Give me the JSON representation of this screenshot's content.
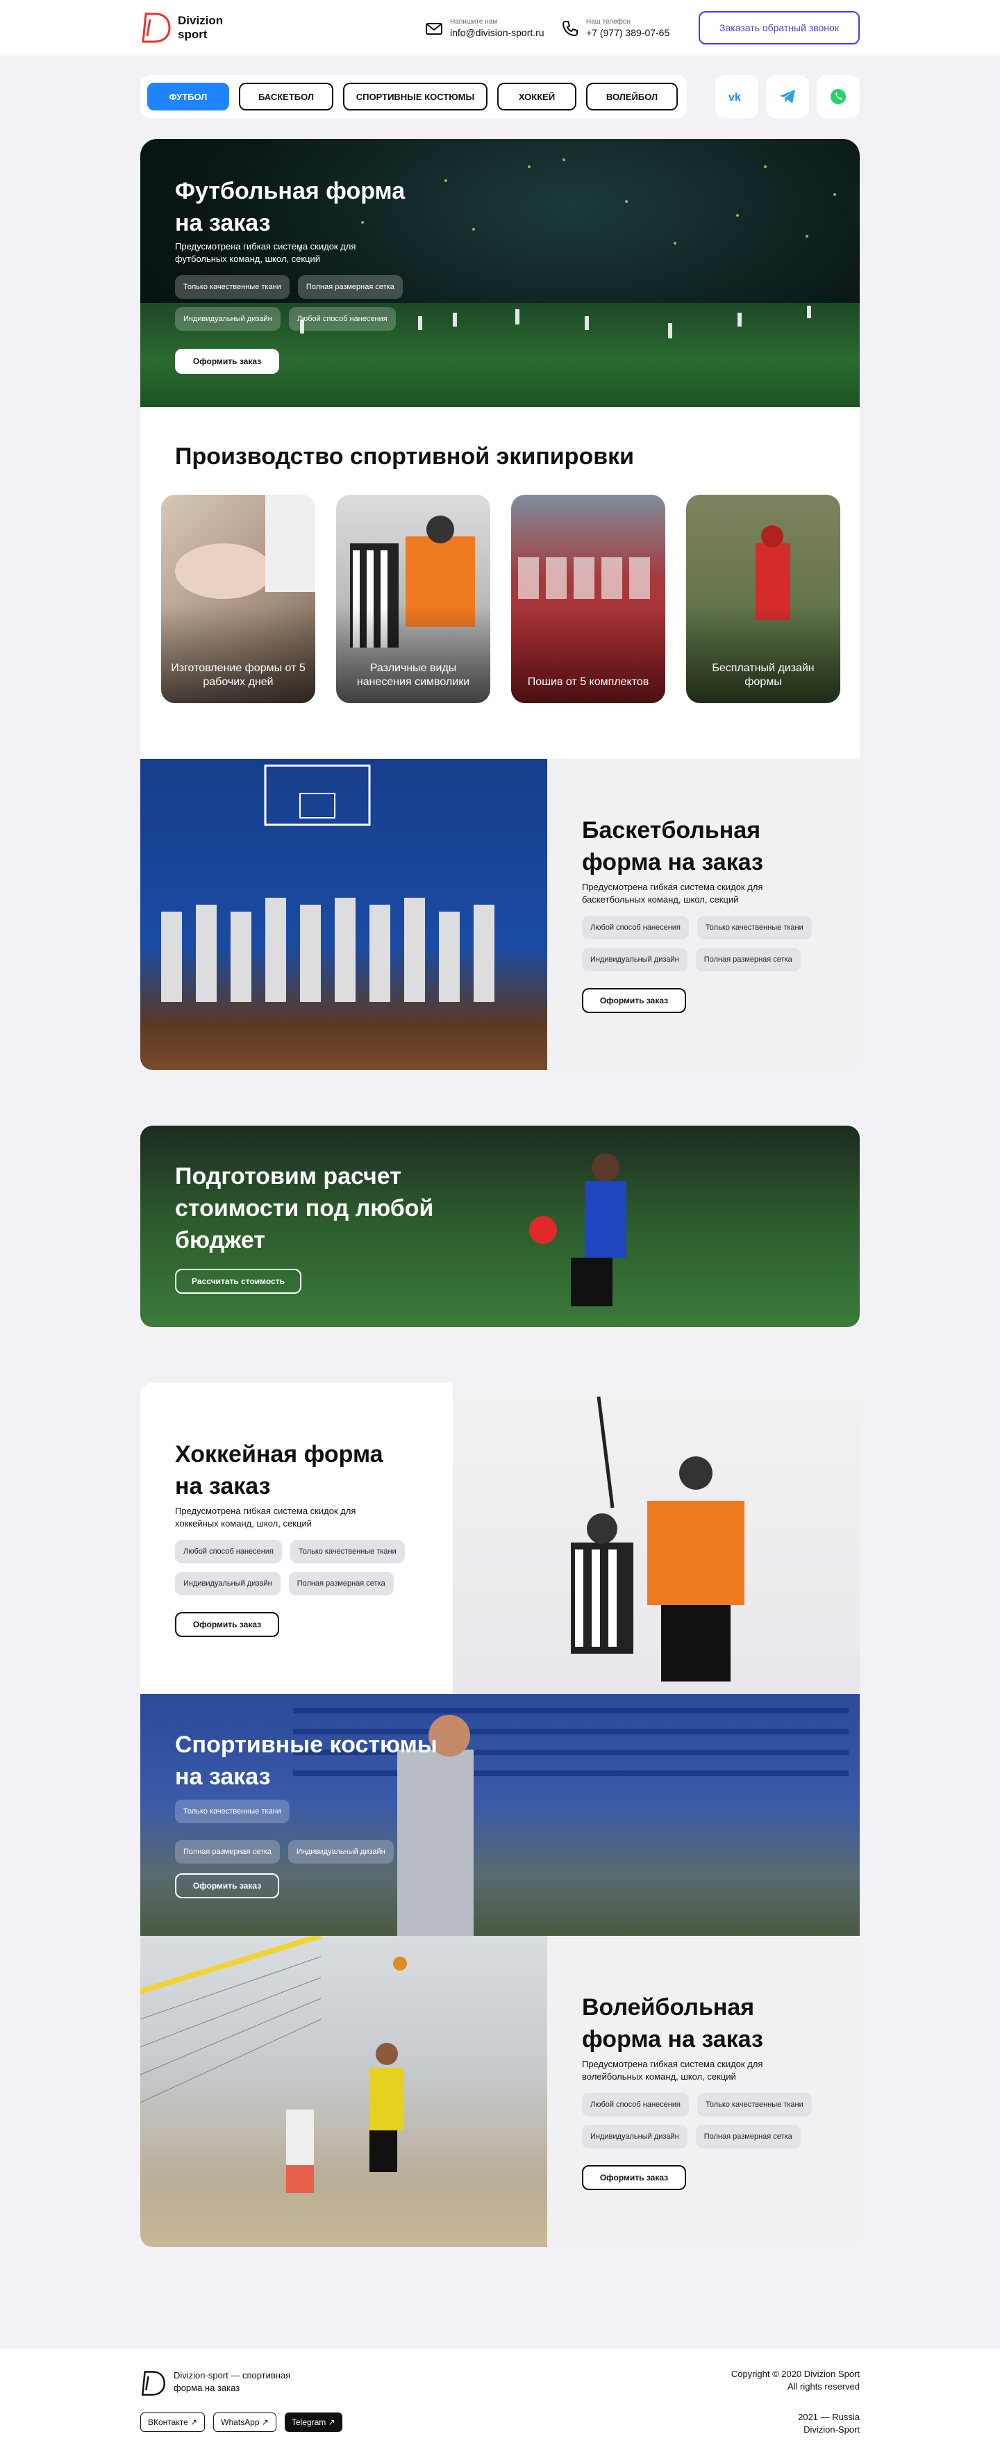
{
  "header": {
    "logo_line1": "Divizion",
    "logo_line2": "sport",
    "email_label": "Напишите нам",
    "email": "info@division-sport.ru",
    "phone_label": "Наш телефон",
    "phone": "+7 (977) 389-07-65",
    "callback_button": "Заказать обратный звонок"
  },
  "tabs": [
    {
      "label": "ФУТБОЛ",
      "active": true
    },
    {
      "label": "БАСКЕТБОЛ",
      "active": false
    },
    {
      "label": "СПОРТИВНЫЕ КОСТЮМЫ",
      "active": false
    },
    {
      "label": "ХОККЕЙ",
      "active": false
    },
    {
      "label": "ВОЛЕЙБОЛ",
      "active": false
    }
  ],
  "social": [
    "vk-icon",
    "telegram-icon",
    "whatsapp-icon"
  ],
  "colors": {
    "accent": "#1f84ff",
    "callback": "#4a3fd8",
    "bg": "#f1f1f6"
  },
  "football": {
    "title": "Футбольная форма на заказ",
    "subtitle": "Предусмотрена гибкая система скидок для футбольных команд, школ, секций",
    "chips": [
      "Только качественные ткани",
      "Полная размерная сетка",
      "Индивидуальный дизайн",
      "Любой способ нанесения"
    ],
    "button": "Оформить заказ"
  },
  "production": {
    "title": "Производство спортивной экипировки",
    "cards": [
      {
        "caption": "Изготовление формы от 5 рабочих дней"
      },
      {
        "caption": "Различные виды нанесения символики"
      },
      {
        "caption": "Пошив от 5 комплектов"
      },
      {
        "caption": "Бесплатный дизайн формы"
      }
    ]
  },
  "basketball": {
    "title": "Баскетбольная форма на заказ",
    "subtitle": "Предусмотрена гибкая система скидок для баскетбольных команд, школ, секций",
    "chips": [
      "Любой способ нанесения",
      "Только качественные ткани",
      "Индивидуальный дизайн",
      "Полная размерная сетка"
    ],
    "button": "Оформить заказ"
  },
  "calc": {
    "title": "Подготовим расчет стоимости под любой бюджет",
    "button": "Рассчитать стоимость"
  },
  "hockey": {
    "title": "Хоккейная форма на заказ",
    "subtitle": "Предусмотрена гибкая система скидок для хоккейных команд, школ, секций",
    "chips": [
      "Любой способ нанесения",
      "Только качественные ткани",
      "Индивидуальный дизайн",
      "Полная размерная сетка"
    ],
    "button": "Оформить заказ"
  },
  "suits": {
    "title": "Спортивные костюмы на заказ",
    "chips": [
      "Только качественные ткани",
      "Полная размерная сетка",
      "Индивидуальный дизайн"
    ],
    "button": "Оформить заказ"
  },
  "volleyball": {
    "title": "Волейбольная форма на заказ",
    "subtitle": "Предусмотрена гибкая система скидок для волейбольных команд, школ, секций",
    "chips": [
      "Любой способ нанесения",
      "Только качественные ткани",
      "Индивидуальный дизайн",
      "Полная размерная сетка"
    ],
    "button": "Оформить заказ"
  },
  "footer": {
    "tagline": "Divizion-sport — спортивная форма на заказ",
    "links": [
      "ВКонтакте ↗",
      "WhatsApp ↗",
      "Telegram ↗"
    ],
    "copyright1": "Copyright © 2020 Divizion Sport",
    "copyright2": "All rights reserved",
    "year": "2021 — Russia",
    "brand": "Divizion-Sport"
  }
}
